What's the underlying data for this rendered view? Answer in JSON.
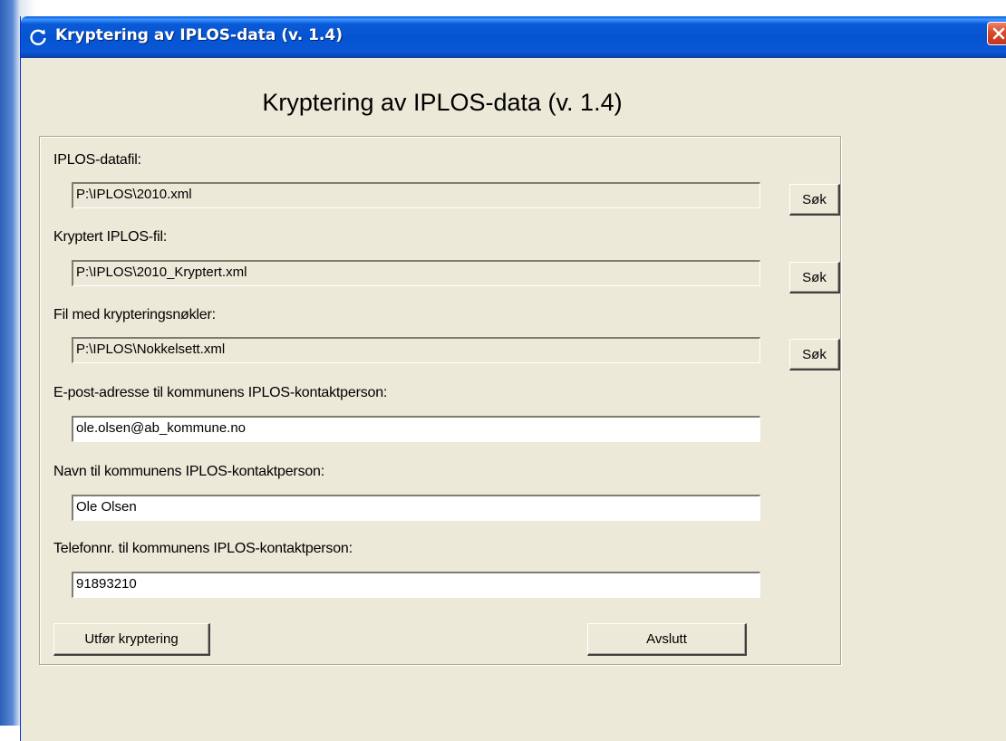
{
  "window": {
    "title": "Kryptering av IPLOS-data (v. 1.4)"
  },
  "heading": "Kryptering av IPLOS-data (v. 1.4)",
  "form": {
    "datafil_label": "IPLOS-datafil:",
    "datafil_value": "P:\\IPLOS\\2010.xml",
    "kryptert_label": "Kryptert IPLOS-fil:",
    "kryptert_value": "P:\\IPLOS\\2010_Kryptert.xml",
    "nokler_label": "Fil med krypteringsnøkler:",
    "nokler_value": "P:\\IPLOS\\Nokkelsett.xml",
    "epost_label": "E-post-adresse til kommunens IPLOS-kontaktperson:",
    "epost_value": "ole.olsen@ab_kommune.no",
    "navn_label": "Navn til kommunens IPLOS-kontaktperson:",
    "navn_value": "Ole Olsen",
    "telefon_label": "Telefonnr. til kommunens IPLOS-kontaktperson:",
    "telefon_value": "91893210",
    "browse_label": "Søk"
  },
  "buttons": {
    "encrypt_label": "Utfør kryptering",
    "exit_label": "Avslutt"
  },
  "icons": {
    "app_icon": "refresh-icon",
    "close_icon": "close-icon"
  },
  "colors": {
    "titlebar": "#0453d1",
    "window_bg": "#ece9d8",
    "close_button": "#d9482a"
  }
}
